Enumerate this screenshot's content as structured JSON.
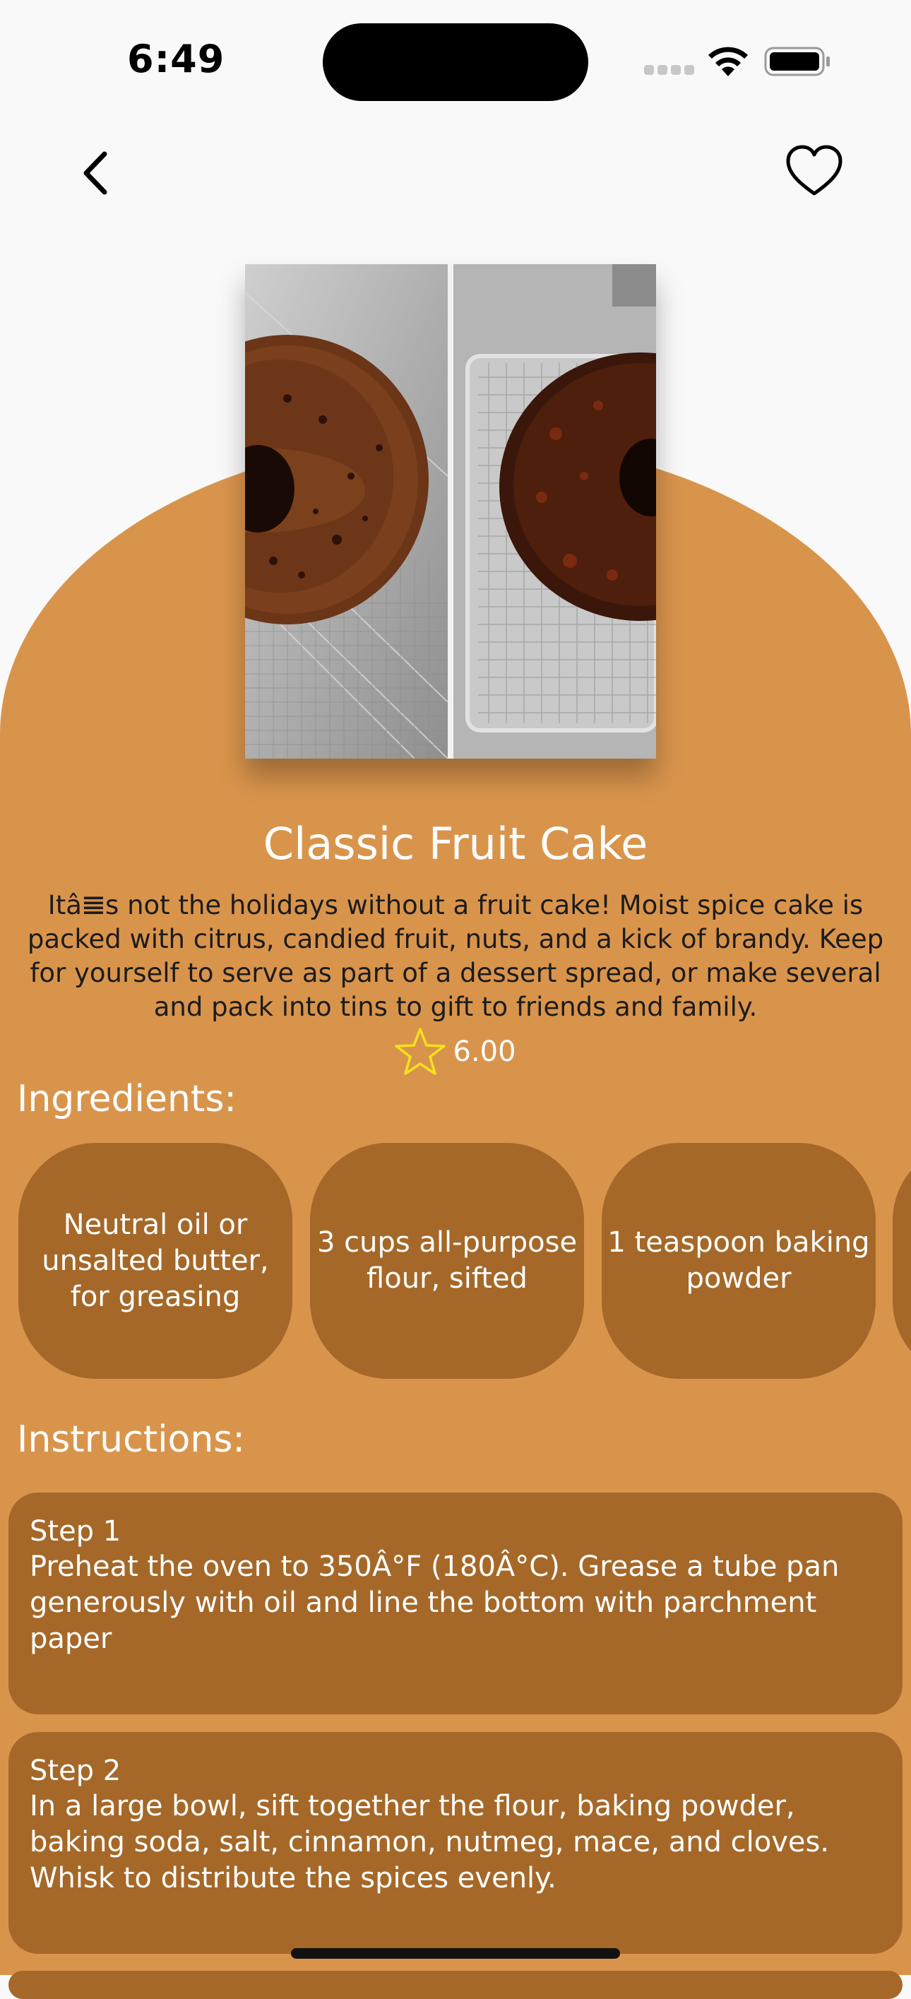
{
  "status_bar": {
    "time": "6:49"
  },
  "header": {
    "back_icon": "chevron-left-icon",
    "favorite_icon": "heart-outline-icon"
  },
  "recipe": {
    "title": "Classic Fruit Cake",
    "description": "Itâ𝌆s not the holidays without a fruit cake! Moist spice cake is packed with citrus, candied fruit, nuts, and a kick of brandy. Keep for yourself to serve as part of a dessert spread, or make several and pack into tins to gift to friends and family.",
    "rating": "6.00",
    "rating_icon": "star-outline-icon"
  },
  "ingredients": {
    "heading": "Ingredients:",
    "items": [
      {
        "label": "Neutral oil or unsalted butter, for greasing"
      },
      {
        "label": "3 cups all-purpose flour, sifted"
      },
      {
        "label": "1 teaspoon baking powder"
      },
      {
        "label": ""
      }
    ]
  },
  "instructions": {
    "heading": "Instructions:",
    "steps": [
      {
        "title": "Step 1",
        "text": "Preheat the oven to 350Â°F (180Â°C). Grease a tube pan generously with oil and line the bottom with parchment paper"
      },
      {
        "title": "Step 2",
        "text": "In a large bowl, sift together the flour, baking powder, baking soda, salt, cinnamon, nutmeg, mace, and cloves. Whisk to distribute the spices evenly."
      }
    ]
  },
  "colors": {
    "background": "#f9f9f9",
    "accent": "#d9944c",
    "card": "#a56828",
    "star": "#f5e21c"
  }
}
